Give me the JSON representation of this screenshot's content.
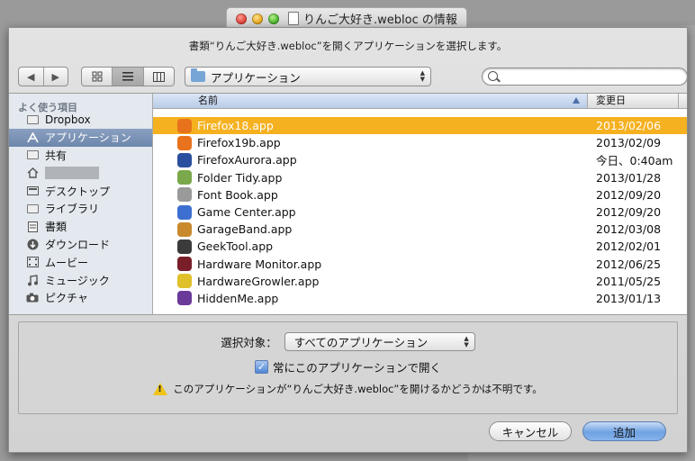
{
  "window": {
    "title": "りんご大好き.webloc の情報"
  },
  "dialog": {
    "message": "書類“りんご大好き.webloc”を開くアプリケーションを選択します。",
    "location_popup": "アプリケーション",
    "search_placeholder": "",
    "nav_back": "◀",
    "nav_forward": "▶"
  },
  "sidebar": {
    "header": "よく使う項目",
    "items": [
      {
        "label": "Dropbox",
        "icon": "folder-icon"
      },
      {
        "label": "アプリケーション",
        "icon": "applications-icon",
        "selected": true
      },
      {
        "label": "共有",
        "icon": "folder-icon"
      },
      {
        "label": "",
        "icon": "home-icon"
      },
      {
        "label": "デスクトップ",
        "icon": "desktop-icon"
      },
      {
        "label": "ライブラリ",
        "icon": "folder-icon"
      },
      {
        "label": "書類",
        "icon": "documents-icon"
      },
      {
        "label": "ダウンロード",
        "icon": "downloads-icon"
      },
      {
        "label": "ムービー",
        "icon": "movies-icon"
      },
      {
        "label": "ミュージック",
        "icon": "music-icon"
      },
      {
        "label": "ピクチャ",
        "icon": "camera-icon"
      }
    ]
  },
  "list": {
    "col_name": "名前",
    "col_date": "変更日",
    "rows": [
      {
        "name": "Firefox18.app",
        "date": "2013/02/06",
        "selected": true,
        "color": "#e8731c"
      },
      {
        "name": "Firefox19b.app",
        "date": "2013/02/09",
        "color": "#e8731c"
      },
      {
        "name": "FirefoxAurora.app",
        "date": "今日、0:40am",
        "color": "#2a4f9e"
      },
      {
        "name": "Folder Tidy.app",
        "date": "2013/01/28",
        "color": "#7aa84a"
      },
      {
        "name": "Font Book.app",
        "date": "2012/09/20",
        "color": "#9a9a9a"
      },
      {
        "name": "Game Center.app",
        "date": "2012/09/20",
        "color": "#3d6fd1"
      },
      {
        "name": "GarageBand.app",
        "date": "2012/03/08",
        "color": "#c98a2e"
      },
      {
        "name": "GeekTool.app",
        "date": "2012/02/01",
        "color": "#3b3b3b"
      },
      {
        "name": "Hardware Monitor.app",
        "date": "2012/06/25",
        "color": "#7a1f2a"
      },
      {
        "name": "HardwareGrowler.app",
        "date": "2011/05/25",
        "color": "#e0c12a"
      },
      {
        "name": "HiddenMe.app",
        "date": "2013/01/13",
        "color": "#6a3a9a"
      }
    ]
  },
  "options": {
    "target_label": "選択対象：",
    "target_value": "すべてのアプリケーション",
    "always_open_label": "常にこのアプリケーションで開く",
    "always_open_checked": true,
    "warning": "このアプリケーションが“りんご大好き.webloc”を開けるかどうかは不明です。"
  },
  "buttons": {
    "cancel": "キャンセル",
    "add": "追加"
  }
}
